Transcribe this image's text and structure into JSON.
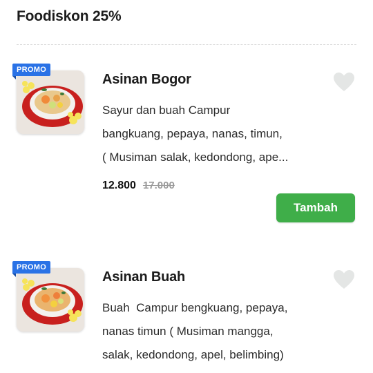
{
  "section": {
    "title": "Foodiskon 25%"
  },
  "items": [
    {
      "badge": "PROMO",
      "name": "Asinan Bogor",
      "desc_lines": [
        "Sayur dan buah Campur",
        "bangkuang, pepaya, nanas, timun,",
        "( Musiman salak, kedondong, ape..."
      ],
      "price": "12.800",
      "old_price": "17.000",
      "button_label": "Tambah",
      "favorite_icon": "heart-icon"
    },
    {
      "badge": "PROMO",
      "name": "Asinan Buah",
      "desc_lines": [
        "Buah  Campur bengkuang, pepaya,",
        "nanas timun ( Musiman mangga,",
        "salak, kedondong, apel, belimbing)"
      ],
      "favorite_icon": "heart-icon"
    }
  ],
  "colors": {
    "primary_button": "#3fae49",
    "promo_badge": "#2a72e6",
    "heart": "#e4e6e5"
  }
}
